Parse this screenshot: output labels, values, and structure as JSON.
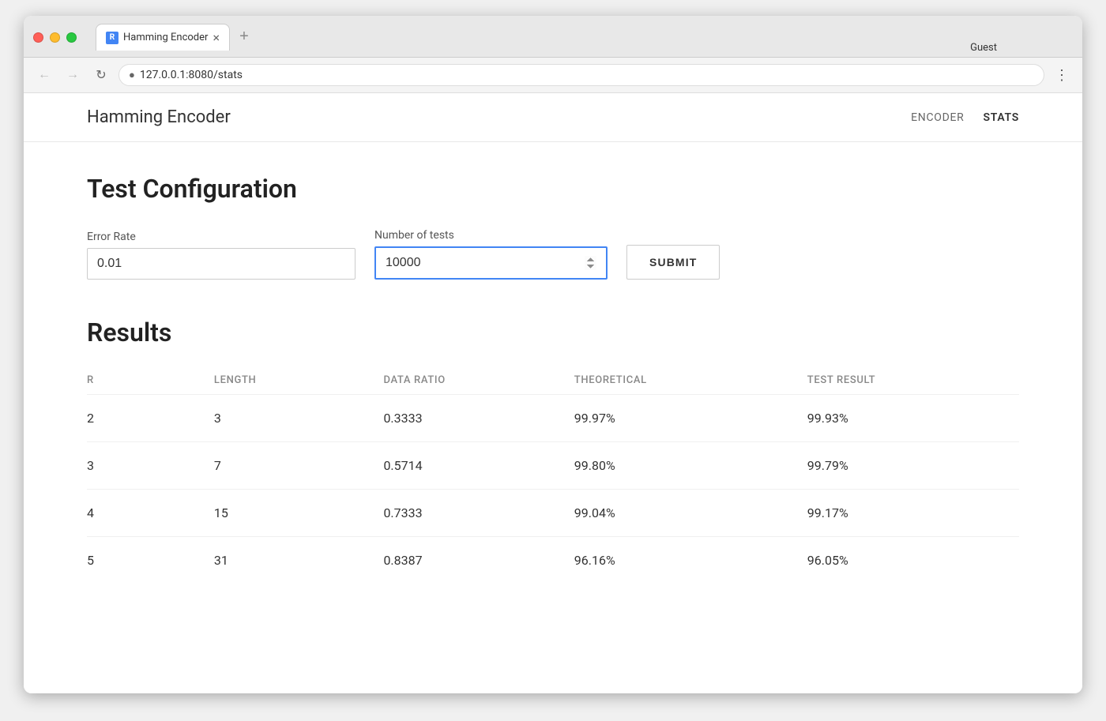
{
  "browser": {
    "tab_title": "Hamming Encoder",
    "tab_favicon": "R",
    "url": "127.0.0.1:8080/stats",
    "url_prefix": "127.0.0.1:8080/stats",
    "guest_label": "Guest"
  },
  "app": {
    "title": "Hamming Encoder",
    "nav": {
      "encoder": "ENCODER",
      "stats": "STATS"
    }
  },
  "config_section": {
    "title": "Test Configuration",
    "error_rate_label": "Error Rate",
    "error_rate_value": "0.01",
    "num_tests_label": "Number of tests",
    "num_tests_value": "10000",
    "submit_label": "SUBMIT"
  },
  "results_section": {
    "title": "Results",
    "columns": {
      "r": "R",
      "length": "LENGTH",
      "data_ratio": "DATA RATIO",
      "theoretical": "THEORETICAL",
      "test_result": "TEST RESULT"
    },
    "rows": [
      {
        "r": "2",
        "length": "3",
        "data_ratio": "0.3333",
        "theoretical": "99.97%",
        "test_result": "99.93%"
      },
      {
        "r": "3",
        "length": "7",
        "data_ratio": "0.5714",
        "theoretical": "99.80%",
        "test_result": "99.79%"
      },
      {
        "r": "4",
        "length": "15",
        "data_ratio": "0.7333",
        "theoretical": "99.04%",
        "test_result": "99.17%"
      },
      {
        "r": "5",
        "length": "31",
        "data_ratio": "0.8387",
        "theoretical": "96.16%",
        "test_result": "96.05%"
      }
    ]
  }
}
